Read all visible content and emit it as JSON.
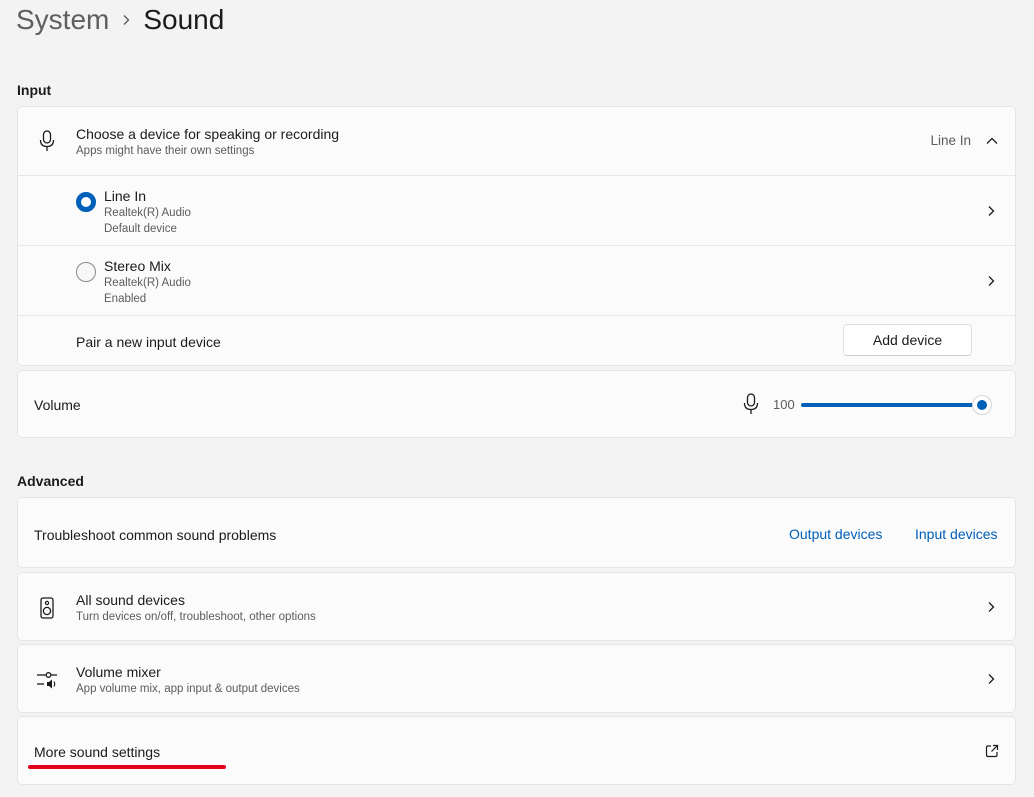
{
  "breadcrumb": {
    "parent": "System",
    "current": "Sound"
  },
  "input_section": {
    "title": "Input",
    "device_chooser": {
      "title": "Choose a device for speaking or recording",
      "subtitle": "Apps might have their own settings",
      "selected": "Line In"
    },
    "devices": [
      {
        "name": "Line In",
        "driver": "Realtek(R) Audio",
        "status": "Default device",
        "selected": true
      },
      {
        "name": "Stereo Mix",
        "driver": "Realtek(R) Audio",
        "status": "Enabled",
        "selected": false
      }
    ],
    "pair": {
      "label": "Pair a new input device",
      "button": "Add device"
    },
    "volume": {
      "label": "Volume",
      "value": "100",
      "level": 100
    }
  },
  "advanced_section": {
    "title": "Advanced",
    "troubleshoot": {
      "label": "Troubleshoot common sound problems",
      "output_link": "Output devices",
      "input_link": "Input devices"
    },
    "all_devices": {
      "title": "All sound devices",
      "subtitle": "Turn devices on/off, troubleshoot, other options"
    },
    "mixer": {
      "title": "Volume mixer",
      "subtitle": "App volume mix, app input & output devices"
    },
    "more": {
      "label": "More sound settings"
    }
  },
  "colors": {
    "accent": "#005fb8",
    "background": "#f3f3f3",
    "card": "#fbfbfb",
    "annotation_underline": "#e3001b"
  }
}
